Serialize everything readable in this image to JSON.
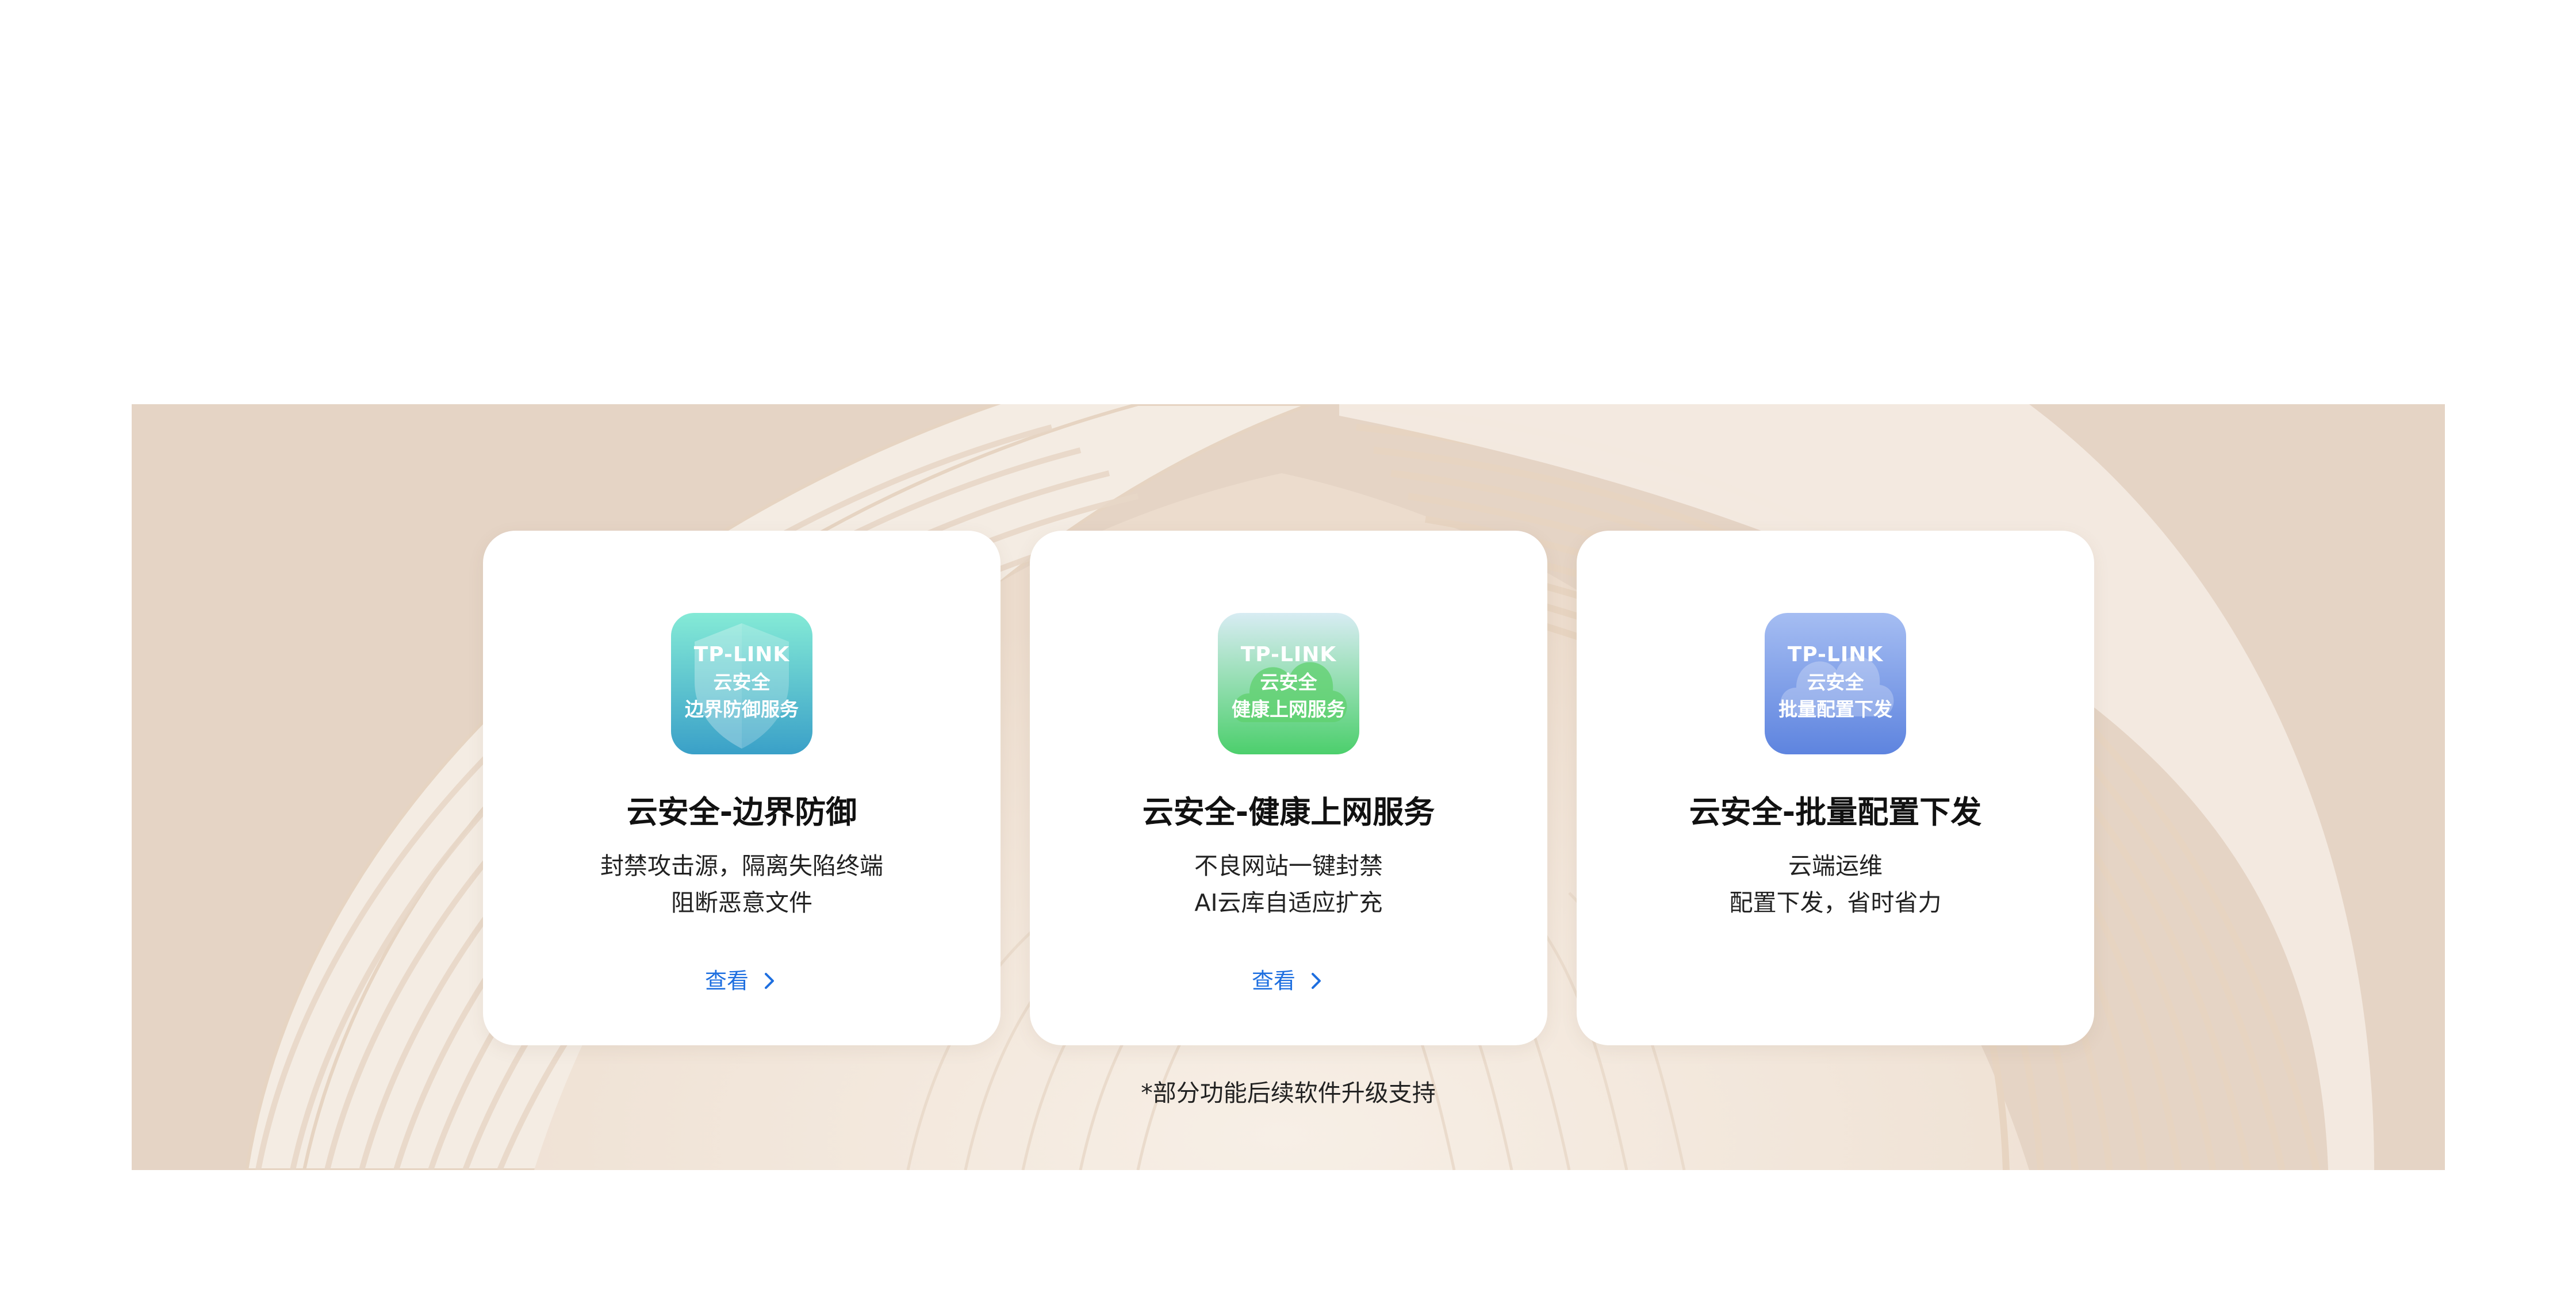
{
  "cards": [
    {
      "icon": {
        "brand": "TP-LINK",
        "line1": "云安全",
        "line2": "边界防御服务",
        "shape": "shield-icon"
      },
      "title": "云安全-边界防御",
      "desc_line1": "封禁攻击源，隔离失陷终端",
      "desc_line2": "阻断恶意文件",
      "link_label": "查看"
    },
    {
      "icon": {
        "brand": "TP-LINK",
        "line1": "云安全",
        "line2": "健康上网服务",
        "shape": "cloud-icon"
      },
      "title": "云安全-健康上网服务",
      "desc_line1": "不良网站一键封禁",
      "desc_line2": "AI云库自适应扩充",
      "link_label": "查看"
    },
    {
      "icon": {
        "brand": "TP-LINK",
        "line1": "云安全",
        "line2": "批量配置下发",
        "shape": "cloud-icon"
      },
      "title": "云安全-批量配置下发",
      "desc_line1": "云端运维",
      "desc_line2": "配置下发，省时省力",
      "link_label": ""
    }
  ],
  "footnote": "*部分功能后续软件升级支持",
  "colors": {
    "banner_bg": "#e6d6c8",
    "link": "#1e6fe0",
    "icon1_gradient": [
      "#7fe6d2",
      "#3a9ec9"
    ],
    "icon2_gradient": [
      "#d6ecf2",
      "#4fcf6e"
    ],
    "icon3_gradient": [
      "#9fb8f0",
      "#5f85e0"
    ]
  }
}
